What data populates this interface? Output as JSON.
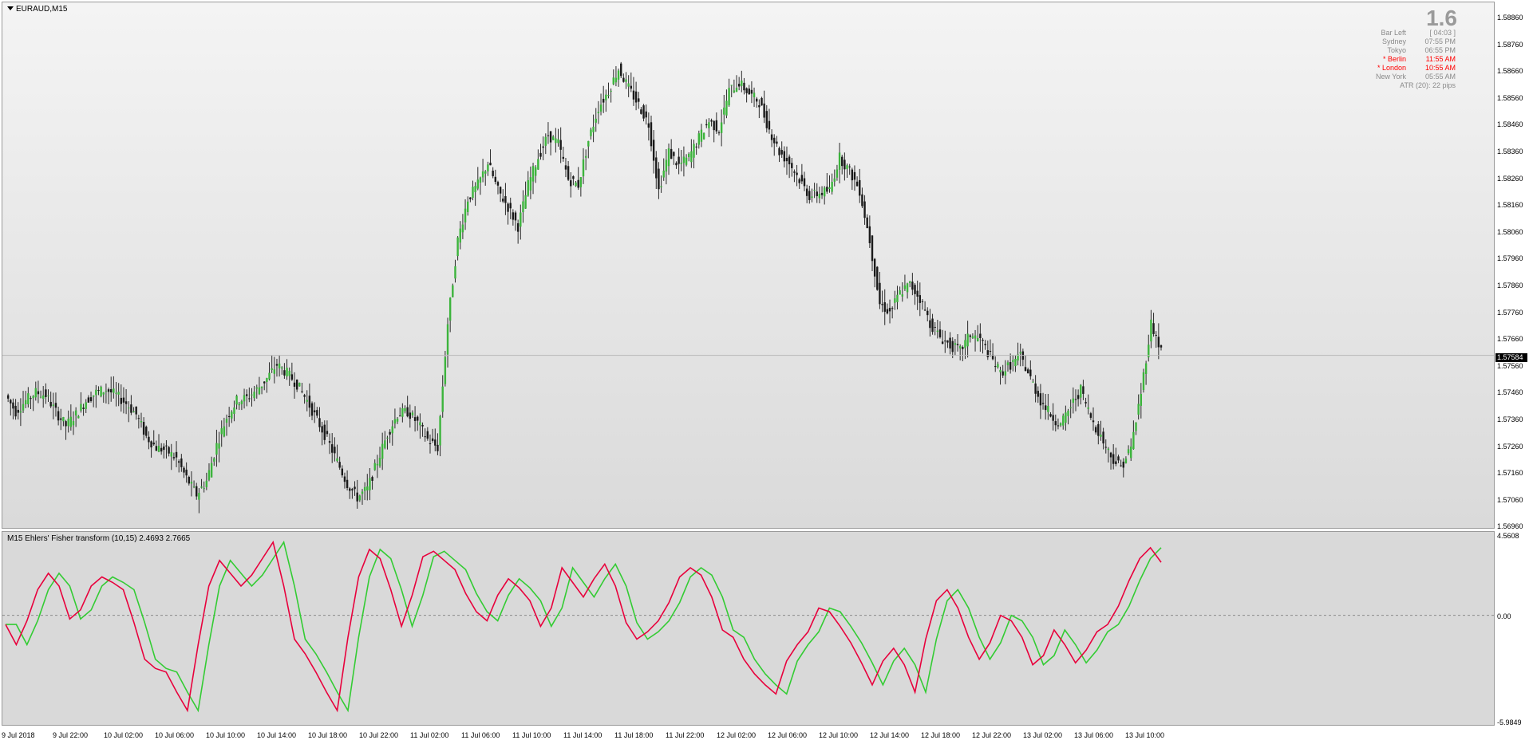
{
  "chart": {
    "symbol_tf": "EURAUD,M15",
    "timeframe_big": "1.6"
  },
  "info_panel": {
    "rows": [
      {
        "label": "Bar Left",
        "value": "[ 04:03 ]",
        "highlight": false
      },
      {
        "label": "Sydney",
        "value": "07:55 PM",
        "highlight": false
      },
      {
        "label": "Tokyo",
        "value": "06:55 PM",
        "highlight": false
      },
      {
        "label": "* Berlin",
        "value": "11:55 AM",
        "highlight": true
      },
      {
        "label": "* London",
        "value": "10:55 AM",
        "highlight": true
      },
      {
        "label": "New York",
        "value": "05:55 AM",
        "highlight": false
      }
    ],
    "atr": "ATR (20): 22 pips"
  },
  "price_axis": {
    "ticks": [
      "1.58860",
      "1.58760",
      "1.58660",
      "1.58560",
      "1.58460",
      "1.58360",
      "1.58260",
      "1.58160",
      "1.58060",
      "1.57960",
      "1.57860",
      "1.57760",
      "1.57660",
      "1.57560",
      "1.57460",
      "1.57360",
      "1.57260",
      "1.57160",
      "1.57060",
      "1.56960"
    ],
    "current_price": "1.57584"
  },
  "indicator": {
    "title": "M15 Ehlers' Fisher transform (10,15) 2.4693 2.7665",
    "axis_top": "4.5608",
    "axis_zero": "0.00",
    "axis_bottom": "-5.9849"
  },
  "time_axis": {
    "ticks": [
      "9 Jul 2018",
      "9 Jul 22:00",
      "10 Jul 02:00",
      "10 Jul 06:00",
      "10 Jul 10:00",
      "10 Jul 14:00",
      "10 Jul 18:00",
      "10 Jul 22:00",
      "11 Jul 02:00",
      "11 Jul 06:00",
      "11 Jul 10:00",
      "11 Jul 14:00",
      "11 Jul 18:00",
      "11 Jul 22:00",
      "12 Jul 02:00",
      "12 Jul 06:00",
      "12 Jul 10:00",
      "12 Jul 14:00",
      "12 Jul 18:00",
      "12 Jul 22:00",
      "13 Jul 02:00",
      "13 Jul 06:00",
      "13 Jul 10:00"
    ]
  },
  "chart_data": {
    "type": "line",
    "price_series_close": [
      1.5744,
      1.5738,
      1.5742,
      1.5745,
      1.5744,
      1.5738,
      1.5733,
      1.5737,
      1.5742,
      1.5745,
      1.5746,
      1.5744,
      1.5741,
      1.5737,
      1.5729,
      1.5725,
      1.5724,
      1.5721,
      1.5714,
      1.5708,
      1.5713,
      1.5726,
      1.5736,
      1.5742,
      1.5743,
      1.5746,
      1.575,
      1.5755,
      1.5752,
      1.5748,
      1.5742,
      1.5735,
      1.5728,
      1.572,
      1.5712,
      1.5707,
      1.571,
      1.572,
      1.573,
      1.5737,
      1.5738,
      1.5734,
      1.5728,
      1.5725,
      1.577,
      1.58,
      1.5815,
      1.582,
      1.5828,
      1.5818,
      1.5812,
      1.5805,
      1.582,
      1.583,
      1.5838,
      1.5835,
      1.5822,
      1.582,
      1.5836,
      1.5848,
      1.5854,
      1.5862,
      1.5855,
      1.5849,
      1.5842,
      1.5818,
      1.5832,
      1.5827,
      1.583,
      1.5837,
      1.5843,
      1.584,
      1.5854,
      1.5857,
      1.5853,
      1.585,
      1.584,
      1.5832,
      1.5828,
      1.5822,
      1.5816,
      1.5817,
      1.5818,
      1.583,
      1.5825,
      1.5818,
      1.58,
      1.5777,
      1.5774,
      1.5781,
      1.5784,
      1.5779,
      1.577,
      1.5765,
      1.5762,
      1.576,
      1.5766,
      1.5764,
      1.5758,
      1.5752,
      1.5755,
      1.5758,
      1.575,
      1.5742,
      1.5737,
      1.5733,
      1.574,
      1.5746,
      1.5736,
      1.5729,
      1.5722,
      1.5718,
      1.5725,
      1.5745,
      1.577,
      1.576
    ],
    "fisher_series": [
      -0.5,
      -1.6,
      -0.3,
      1.4,
      2.3,
      1.6,
      -0.2,
      0.3,
      1.6,
      2.1,
      1.8,
      1.4,
      -0.4,
      -2.4,
      -2.9,
      -3.1,
      -4.2,
      -5.2,
      -1.6,
      1.6,
      3.0,
      2.3,
      1.6,
      2.2,
      3.1,
      4.0,
      1.6,
      -1.3,
      -2.1,
      -3.1,
      -4.2,
      -5.2,
      -1.2,
      2.1,
      3.6,
      3.1,
      1.4,
      -0.6,
      1.1,
      3.2,
      3.5,
      3.0,
      2.5,
      1.2,
      0.2,
      -0.3,
      1.1,
      2.0,
      1.5,
      0.8,
      -0.6,
      0.4,
      2.6,
      1.8,
      1.0,
      2.0,
      2.8,
      1.6,
      -0.4,
      -1.3,
      -0.9,
      -0.3,
      0.7,
      2.1,
      2.6,
      2.2,
      1.0,
      -0.8,
      -1.2,
      -2.4,
      -3.2,
      -3.8,
      -4.3,
      -2.5,
      -1.6,
      -0.9,
      0.4,
      0.2,
      -0.6,
      -1.5,
      -2.6,
      -3.8,
      -2.5,
      -1.8,
      -2.7,
      -4.2,
      -1.3,
      0.8,
      1.4,
      0.4,
      -1.2,
      -2.4,
      -1.5,
      0.0,
      -0.3,
      -1.2,
      -2.7,
      -2.2,
      -0.8,
      -1.6,
      -2.6,
      -1.9,
      -0.9,
      -0.5,
      0.5,
      1.9,
      3.1,
      3.7,
      2.9
    ],
    "ylim_price": [
      1.5696,
      1.5886
    ],
    "ylim_indicator": [
      -5.9849,
      4.5608
    ],
    "series": [
      {
        "name": "Fisher",
        "color": "#e8003c"
      },
      {
        "name": "Trigger",
        "color": "#2ecc2e"
      }
    ],
    "colors": {
      "bull": "#3cb43c",
      "bear": "#1a1a1a",
      "wick": "#2a2a2a",
      "fisher": "#e8003c",
      "trigger": "#33cc33"
    }
  }
}
